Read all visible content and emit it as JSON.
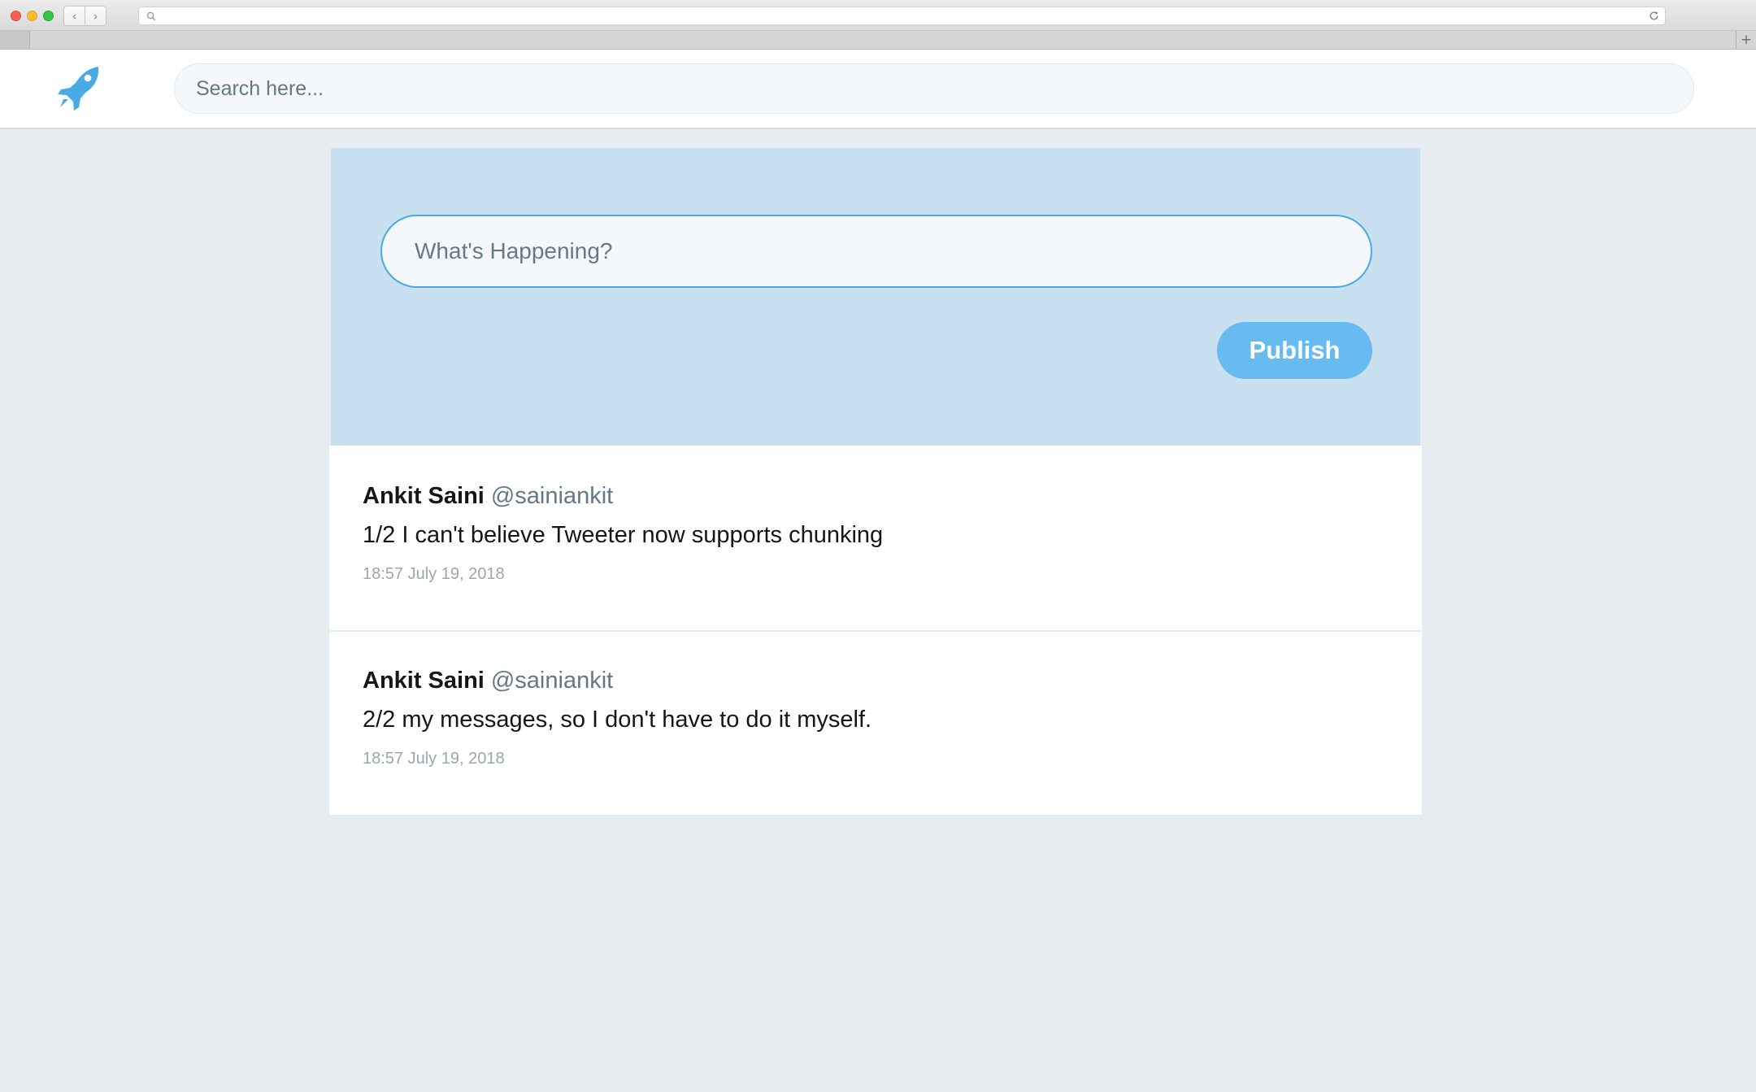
{
  "browser": {
    "back_glyph": "‹",
    "forward_glyph": "›",
    "address_url": "",
    "new_tab_glyph": "+"
  },
  "header": {
    "logo_icon": "rocket-icon",
    "search_placeholder": "Search here...",
    "search_value": ""
  },
  "composer": {
    "placeholder": "What's Happening?",
    "value": "",
    "publish_label": "Publish"
  },
  "tweets": [
    {
      "name": "Ankit Saini",
      "handle": "@sainiankit",
      "text": "1/2 I can't believe Tweeter now supports chunking",
      "timestamp": "18:57 July 19, 2018"
    },
    {
      "name": "Ankit Saini",
      "handle": "@sainiankit",
      "text": "2/2 my messages, so I don't have to do it myself.",
      "timestamp": "18:57 July 19, 2018"
    }
  ],
  "colors": {
    "page_background": "#e6ecf0",
    "brand_blue": "#4aaae6",
    "publish_button": "#67bbf1",
    "composer_background": "#c8e0ef",
    "handle_gray": "#657786",
    "timestamp_gray": "#9aa6b0"
  }
}
